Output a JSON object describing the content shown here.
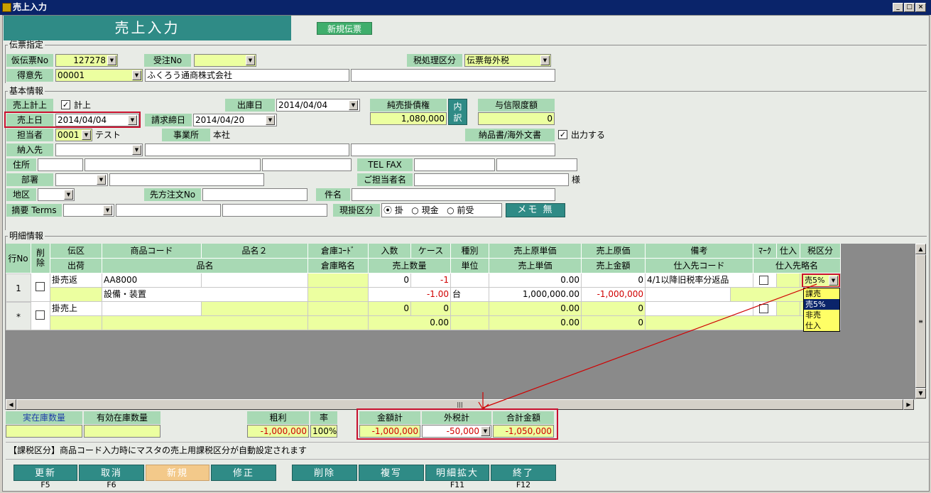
{
  "window": {
    "title": "売上入力"
  },
  "header": {
    "title": "売上入力",
    "mode_badge": "新規伝票"
  },
  "denpyo": {
    "section": "伝票指定",
    "kari_no_label": "仮伝票No",
    "kari_no": "127278",
    "juchu_label": "受注No",
    "juchu": "",
    "tax_label": "税処理区分",
    "tax": "伝票毎外税",
    "tokui_label": "得意先",
    "tokui_code": "00001",
    "tokui_name": "ふくろう通商株式会社"
  },
  "kihon": {
    "section": "基本情報",
    "keijo_label": "売上計上",
    "keijo_check": "計上",
    "shukko_label": "出庫日",
    "shukko": "2014/04/04",
    "jun_label": "純売掛債権",
    "jun": "1,080,000",
    "uchiwake": "内訳",
    "yoshin_label": "与信限度額",
    "yoshin": "0",
    "uriage_label": "売上日",
    "uriage": "2014/04/04",
    "seikyu_label": "請求締日",
    "seikyu": "2014/04/20",
    "tanto_label": "担当者",
    "tanto_code": "0001",
    "tanto_name": "テスト",
    "jigyo_label": "事業所",
    "jigyo": "本社",
    "nohin_label": "納品書/海外文書",
    "nohin_check": "出力する",
    "nonyu_label": "納入先",
    "jusho_label": "住所",
    "telfax_label": "TEL FAX",
    "busho_label": "部署",
    "gotanto_label": "ご担当者名",
    "sama": "様",
    "chiku_label": "地区",
    "sakichumon_label": "先方注文No",
    "kenmei_label": "件名",
    "tekiyo_label": "摘要 Terms",
    "genkake_label": "現掛区分",
    "genkake_opts": [
      "掛",
      "現金",
      "前受"
    ],
    "memo": "メモ 無"
  },
  "meisai": {
    "section": "明細情報",
    "head1": [
      "行No",
      "削除",
      "伝区",
      "商品コード",
      "品名２",
      "倉庫ｺｰﾄﾞ",
      "入数",
      "ケース",
      "種別",
      "売上原単価",
      "売上原価",
      "備考",
      "ﾏｰｸ",
      "仕入",
      "税区分"
    ],
    "head2": [
      "出荷",
      "品名",
      "倉庫略名",
      "売上数量",
      "単位",
      "売上単価",
      "売上金額",
      "仕入先コード",
      "仕入先略名"
    ],
    "rows": [
      {
        "no": "1",
        "denku": "掛売返",
        "code": "AA8000",
        "irisu": "0",
        "case": "-1",
        "gentanka": "0.00",
        "genka": "0",
        "biko": "4/1以降旧税率分返品",
        "zei": "売5%",
        "hinmei": "設備・装置",
        "suryo": "-1.00",
        "tani": "台",
        "tanka": "1,000,000.00",
        "kingaku": "-1,000,000"
      },
      {
        "no": "*",
        "denku": "掛売上",
        "code": "",
        "irisu": "0",
        "case": "0",
        "gentanka": "0.00",
        "genka": "0",
        "biko": "",
        "zei": "",
        "hinmei": "",
        "suryo": "0.00",
        "tani": "",
        "tanka": "0.00",
        "kingaku": "0"
      }
    ],
    "zei_options": [
      "課売",
      "売5%",
      "非売",
      "仕入"
    ]
  },
  "totals": {
    "jitsu_label": "実在庫数量",
    "yuko_label": "有効在庫数量",
    "arari_label": "粗利",
    "arari": "-1,000,000",
    "ritsu_label": "率",
    "ritsu": "100%",
    "kingaku_label": "金額計",
    "kingaku": "-1,000,000",
    "sotozei_label": "外税計",
    "sotozei": "-50,000",
    "gokei_label": "合計金額",
    "gokei": "-1,050,000"
  },
  "message": "【課税区分】商品コード入力時にマスタの売上用課税区分が自動設定されます",
  "fkeys": [
    {
      "label": "更新",
      "key": "F5"
    },
    {
      "label": "取消",
      "key": "F6"
    },
    {
      "label": "新規",
      "key": ""
    },
    {
      "label": "修正",
      "key": ""
    },
    {
      "label": "削除",
      "key": ""
    },
    {
      "label": "複写",
      "key": ""
    },
    {
      "label": "明細拡大",
      "key": "F11"
    },
    {
      "label": "終了",
      "key": "F12"
    }
  ],
  "colors": {
    "accent": "#2f8b86",
    "label_bg": "#a8d9b4",
    "input_bg": "#ecffa0",
    "highlight": "#c8102e"
  }
}
